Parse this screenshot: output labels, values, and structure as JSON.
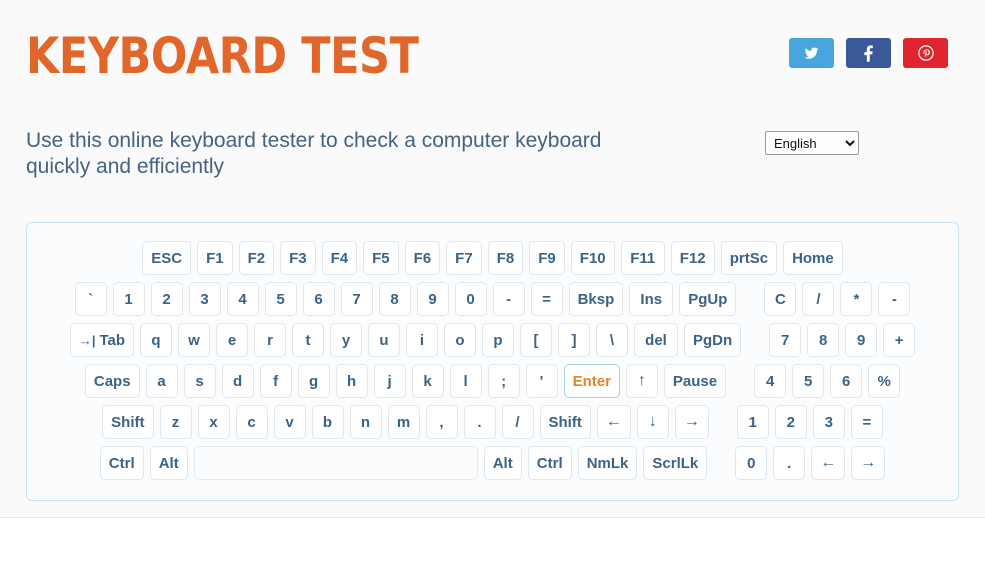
{
  "header": {
    "title": "KEYBOARD TEST",
    "subtitle": "Use this online keyboard tester to check a computer keyboard quickly and efficiently",
    "title_color": "#e1662a",
    "subtitle_color": "#456380"
  },
  "social": [
    {
      "name": "twitter-share-button",
      "label": "Twitter",
      "color": "#48a6de"
    },
    {
      "name": "facebook-share-button",
      "label": "Facebook",
      "color": "#3b5998"
    },
    {
      "name": "pinterest-share-button",
      "label": "Pinterest",
      "color": "#e0252e"
    }
  ],
  "language": {
    "selected": "English",
    "options": [
      "English"
    ]
  },
  "keyboard": {
    "active_key": "Enter",
    "active_color": "#e1842a",
    "rows": [
      {
        "name": "function-row",
        "keys": [
          {
            "label": "ESC",
            "wide": true
          },
          {
            "label": "F1"
          },
          {
            "label": "F2"
          },
          {
            "label": "F3"
          },
          {
            "label": "F4"
          },
          {
            "label": "F5"
          },
          {
            "label": "F6"
          },
          {
            "label": "F7"
          },
          {
            "label": "F8"
          },
          {
            "label": "F9"
          },
          {
            "label": "F10",
            "wide": true
          },
          {
            "label": "F11",
            "wide": true
          },
          {
            "label": "F12",
            "wide": true
          },
          {
            "label": "prtSc",
            "wide": true
          },
          {
            "label": "Home",
            "wide": true
          }
        ]
      },
      {
        "name": "number-row",
        "keys": [
          {
            "label": "`"
          },
          {
            "label": "1"
          },
          {
            "label": "2"
          },
          {
            "label": "3"
          },
          {
            "label": "4"
          },
          {
            "label": "5"
          },
          {
            "label": "6"
          },
          {
            "label": "7"
          },
          {
            "label": "8"
          },
          {
            "label": "9"
          },
          {
            "label": "0"
          },
          {
            "label": "-"
          },
          {
            "label": "="
          },
          {
            "label": "Bksp",
            "wide": true
          },
          {
            "label": "Ins",
            "wide": true
          },
          {
            "label": "PgUp",
            "wide": true
          },
          {
            "gap": true
          },
          {
            "label": "C"
          },
          {
            "label": "/"
          },
          {
            "label": "*"
          },
          {
            "label": "-"
          }
        ]
      },
      {
        "name": "qwerty-row",
        "keys": [
          {
            "label": "Tab",
            "wide": true,
            "glyph": "tab-arrow-icon"
          },
          {
            "label": "q"
          },
          {
            "label": "w"
          },
          {
            "label": "e"
          },
          {
            "label": "r"
          },
          {
            "label": "t"
          },
          {
            "label": "y"
          },
          {
            "label": "u"
          },
          {
            "label": "i"
          },
          {
            "label": "o"
          },
          {
            "label": "p"
          },
          {
            "label": "["
          },
          {
            "label": "]"
          },
          {
            "label": "\\"
          },
          {
            "label": "del",
            "wide": true
          },
          {
            "label": "PgDn",
            "wide": true
          },
          {
            "gap": true
          },
          {
            "label": "7"
          },
          {
            "label": "8"
          },
          {
            "label": "9"
          },
          {
            "label": "+"
          }
        ]
      },
      {
        "name": "home-row",
        "keys": [
          {
            "label": "Caps",
            "wide": true
          },
          {
            "label": "a"
          },
          {
            "label": "s"
          },
          {
            "label": "d"
          },
          {
            "label": "f"
          },
          {
            "label": "g"
          },
          {
            "label": "h"
          },
          {
            "label": "j"
          },
          {
            "label": "k"
          },
          {
            "label": "l"
          },
          {
            "label": ";"
          },
          {
            "label": "'"
          },
          {
            "label": "Enter",
            "wide": true,
            "active": true
          },
          {
            "label": "↑",
            "arrow": true
          },
          {
            "label": "Pause",
            "wide": true
          },
          {
            "gap": true
          },
          {
            "label": "4"
          },
          {
            "label": "5"
          },
          {
            "label": "6"
          },
          {
            "label": "%"
          }
        ]
      },
      {
        "name": "shift-row",
        "keys": [
          {
            "label": "Shift",
            "wide": true
          },
          {
            "label": "z"
          },
          {
            "label": "x"
          },
          {
            "label": "c"
          },
          {
            "label": "v"
          },
          {
            "label": "b"
          },
          {
            "label": "n"
          },
          {
            "label": "m"
          },
          {
            "label": ","
          },
          {
            "label": "."
          },
          {
            "label": "/"
          },
          {
            "label": "Shift",
            "wide": true
          },
          {
            "label": "←",
            "arrow": true
          },
          {
            "label": "↓",
            "arrow": true
          },
          {
            "label": "→",
            "arrow": true
          },
          {
            "gap": true
          },
          {
            "label": "1"
          },
          {
            "label": "2"
          },
          {
            "label": "3"
          },
          {
            "label": "="
          }
        ]
      },
      {
        "name": "bottom-row",
        "keys": [
          {
            "label": "Ctrl",
            "wide": true
          },
          {
            "label": "Alt"
          },
          {
            "label": "",
            "space": true,
            "name": "space-key"
          },
          {
            "label": "Alt"
          },
          {
            "label": "Ctrl",
            "wide": true
          },
          {
            "label": "NmLk",
            "wide": true
          },
          {
            "label": "ScrlLk",
            "wide": true
          },
          {
            "gap": true
          },
          {
            "label": "0"
          },
          {
            "label": "."
          },
          {
            "label": "←",
            "arrow": true
          },
          {
            "label": "→",
            "arrow": true
          }
        ]
      }
    ]
  }
}
